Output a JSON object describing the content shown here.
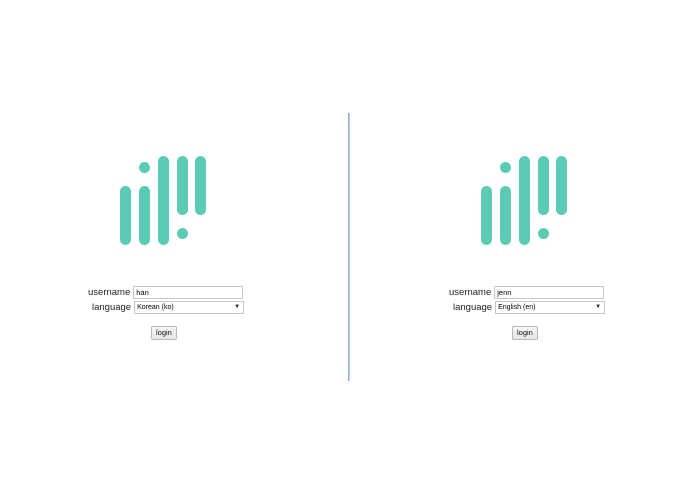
{
  "brand": {
    "accent_color": "#5ccbb5",
    "logo_icon": "bars-and-dots-logo-icon"
  },
  "panels": [
    {
      "username_label": "username",
      "username_value": "han",
      "language_label": "language",
      "language_value": "Korean (ko)",
      "login_label": "login"
    },
    {
      "username_label": "username",
      "username_value": "jenn",
      "language_label": "language",
      "language_value": "English (en)",
      "login_label": "login"
    }
  ]
}
